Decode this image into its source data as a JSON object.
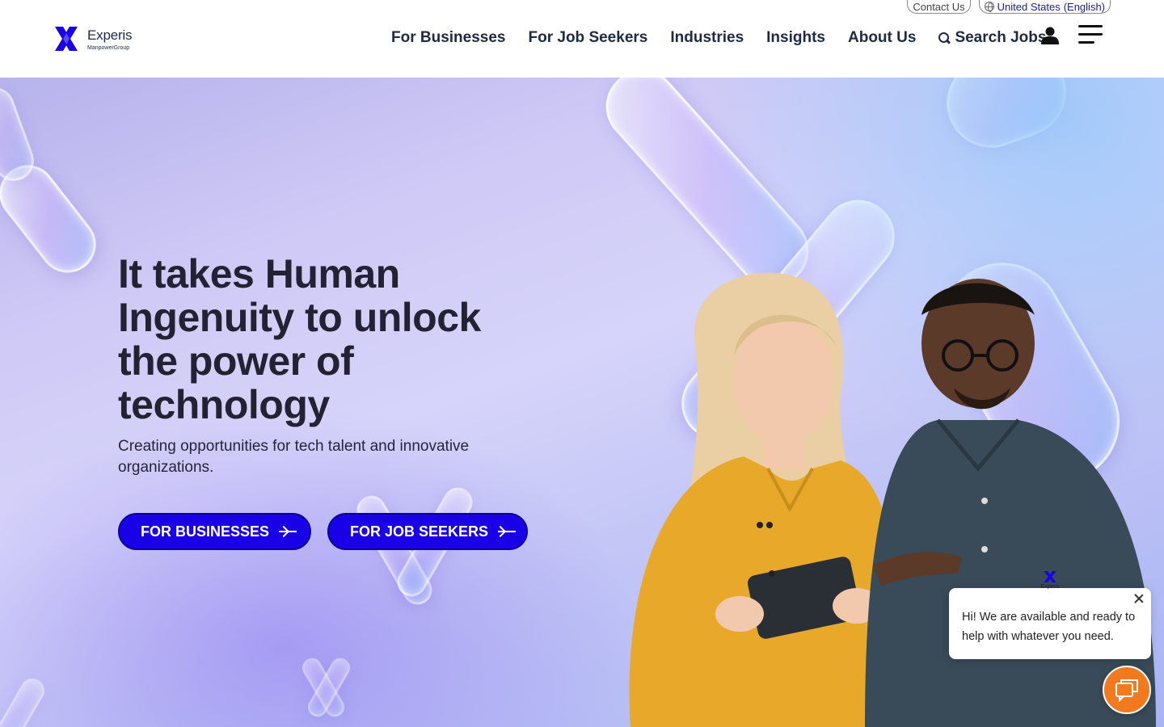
{
  "header": {
    "utility": {
      "contact_label": "Contact Us",
      "country": "United States",
      "language": "(English)"
    },
    "logo": {
      "wordmark": "Experis",
      "sub": "ManpowerGroup"
    },
    "nav": [
      {
        "label": "For Businesses"
      },
      {
        "label": "For Job Seekers"
      },
      {
        "label": "Industries"
      },
      {
        "label": "Insights"
      },
      {
        "label": "About Us"
      },
      {
        "label": "Search Jobs"
      }
    ],
    "icons": {
      "search": "search-icon",
      "account": "user-icon",
      "menu": "hamburger-menu-icon"
    }
  },
  "hero": {
    "headline": "It takes Human Ingenuity to unlock the power of technology",
    "subline": "Creating opportunities for tech talent and innovative organizations.",
    "cta_businesses": "FOR BUSINESSES",
    "cta_job_seekers": "FOR JOB SEEKERS",
    "accent": "#1a00e6"
  },
  "chat": {
    "logo_word": "Experis",
    "message": "Hi! We are available and ready to help with whatever you need.",
    "launcher_color": "#f07a1d"
  },
  "colors": {
    "brand_blue": "#1a00e6",
    "nav_text": "#1f2a44",
    "hero_gradient_start": "#b7b3ec",
    "hero_gradient_end": "#a8b4f4"
  }
}
